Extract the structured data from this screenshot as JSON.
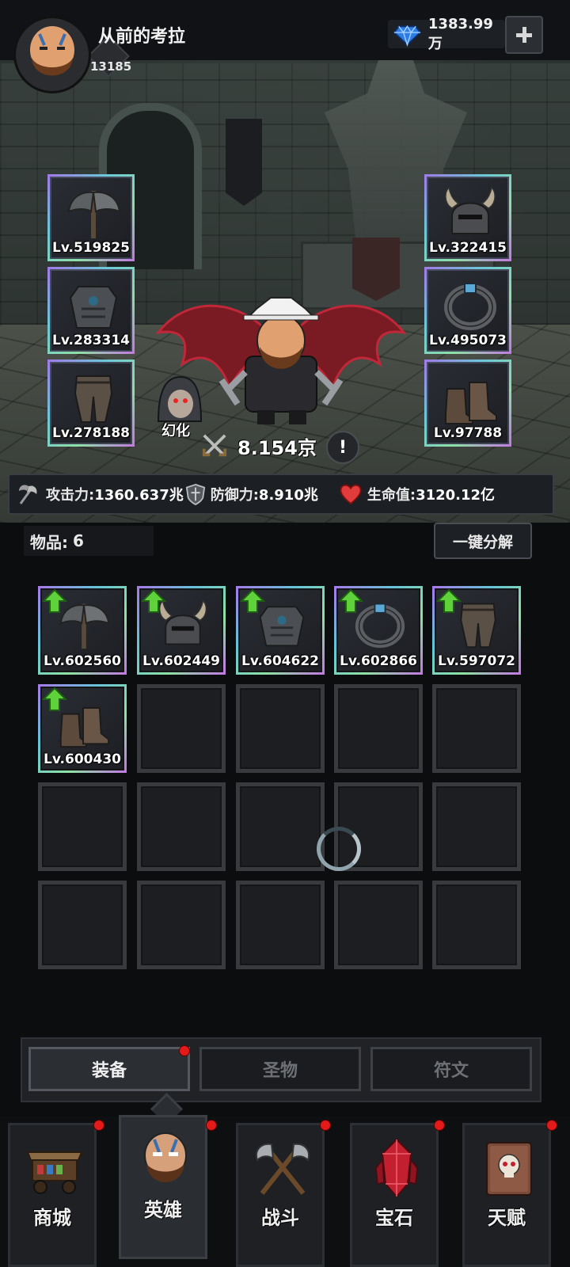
{
  "player": {
    "name": "从前的考拉",
    "level": "13185"
  },
  "currency": {
    "icon": "diamond-gem-icon",
    "amount": "1383.99万"
  },
  "equipped": {
    "left": [
      {
        "icon": "battle-axe-icon",
        "level": "Lv.519825"
      },
      {
        "icon": "chest-armor-icon",
        "level": "Lv.283314"
      },
      {
        "icon": "leg-armor-icon",
        "level": "Lv.278188"
      }
    ],
    "right": [
      {
        "icon": "horned-helmet-icon",
        "level": "Lv.322415"
      },
      {
        "icon": "gem-ring-icon",
        "level": "Lv.495073"
      },
      {
        "icon": "boots-icon",
        "level": "Lv.97788"
      }
    ]
  },
  "hero": {
    "transform_label": "幻化",
    "combat_power": "8.154京"
  },
  "stats": {
    "attack_label": "攻击力:",
    "attack_value": "1360.637兆",
    "defense_label": "防御力:",
    "defense_value": "8.910兆",
    "hp_label": "生命值:",
    "hp_value": "3120.12亿"
  },
  "inventory": {
    "count_label": "物品:",
    "count": "6",
    "decompose_label": "一键分解",
    "items": [
      {
        "icon": "battle-axe-icon",
        "level": "Lv.602560",
        "upgrade": true
      },
      {
        "icon": "horned-helmet-icon",
        "level": "Lv.602449",
        "upgrade": true
      },
      {
        "icon": "chest-armor-icon",
        "level": "Lv.604622",
        "upgrade": true
      },
      {
        "icon": "gem-ring-icon",
        "level": "Lv.602866",
        "upgrade": true
      },
      {
        "icon": "leg-armor-icon",
        "level": "Lv.597072",
        "upgrade": true
      },
      {
        "icon": "boots-icon",
        "level": "Lv.600430",
        "upgrade": true
      }
    ]
  },
  "subtabs": [
    {
      "label": "装备",
      "active": true,
      "dot": true
    },
    {
      "label": "圣物",
      "active": false,
      "dot": false
    },
    {
      "label": "符文",
      "active": false,
      "dot": false
    }
  ],
  "nav": [
    {
      "label": "商城",
      "icon": "shop-cart-icon",
      "dot": true
    },
    {
      "label": "英雄",
      "icon": "hero-face-icon",
      "dot": true,
      "active": true
    },
    {
      "label": "战斗",
      "icon": "crossed-axes-icon",
      "dot": true
    },
    {
      "label": "宝石",
      "icon": "red-crystal-icon",
      "dot": true
    },
    {
      "label": "天赋",
      "icon": "skull-book-icon",
      "dot": true
    }
  ],
  "colors": {
    "upgrade_arrow": "#5fd13a",
    "notification_dot": "#e31a1a",
    "hp_heart": "#e23b3b"
  }
}
